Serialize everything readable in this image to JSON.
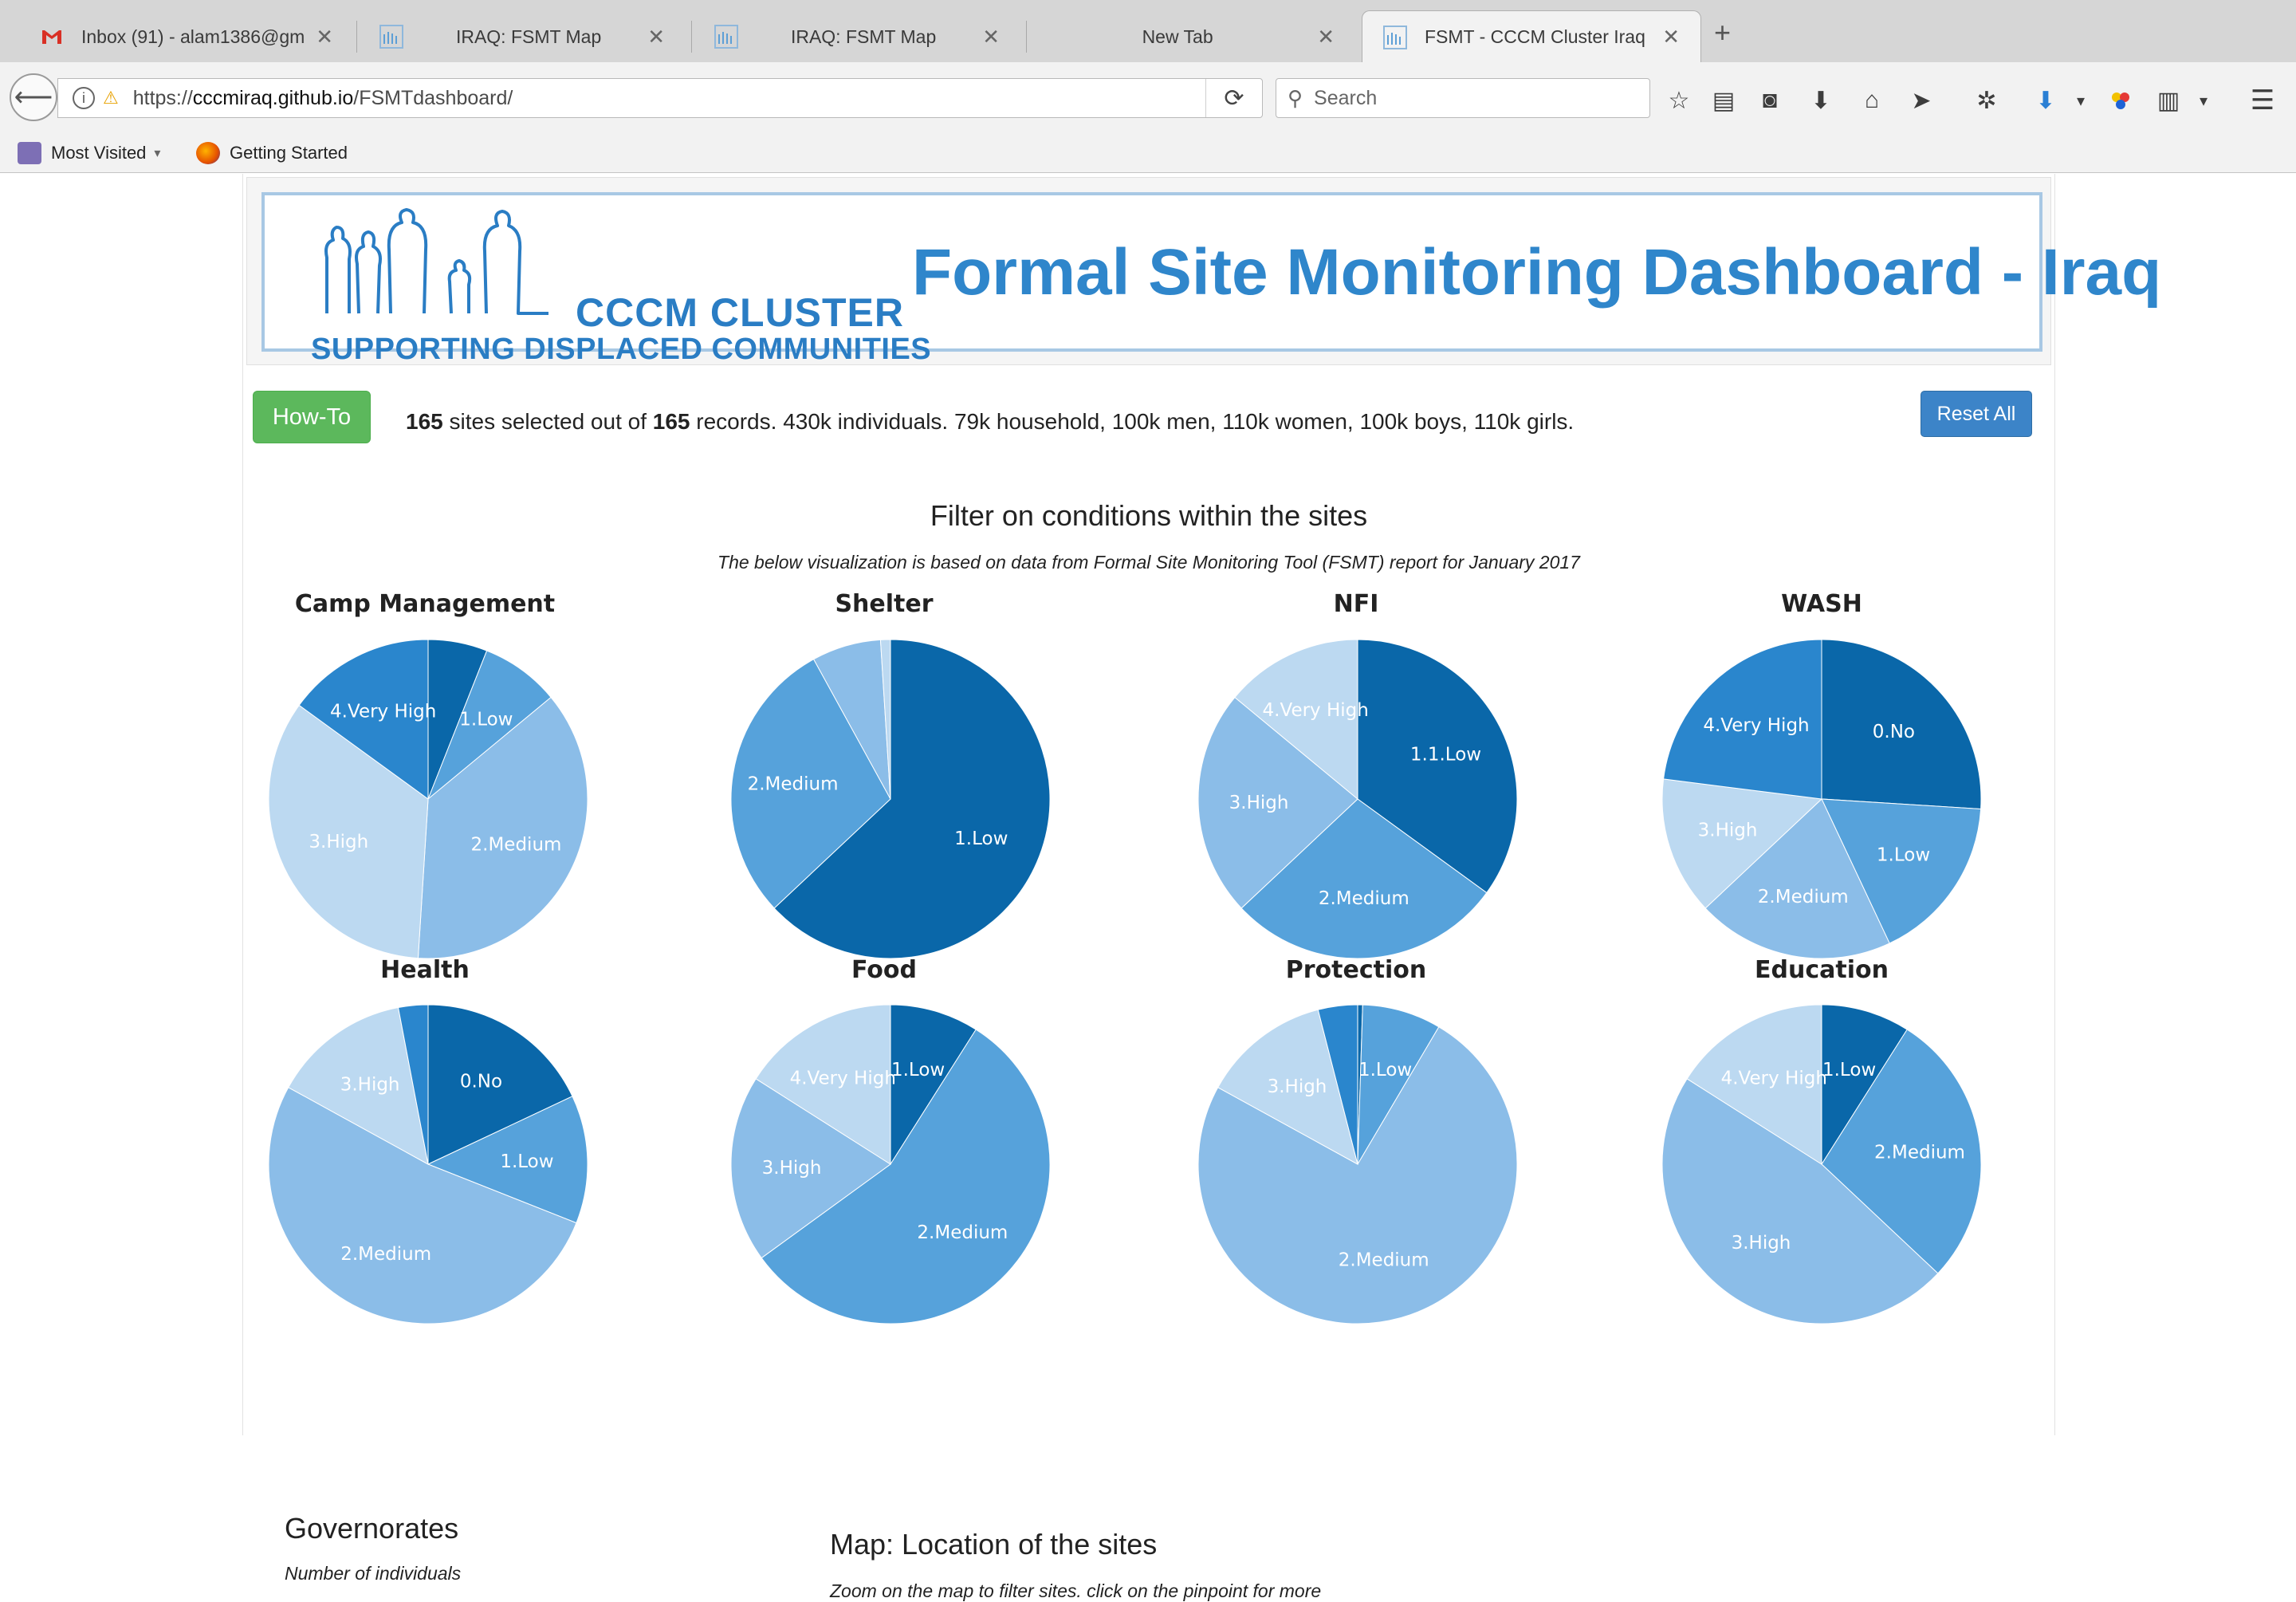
{
  "browser": {
    "tabs": [
      {
        "label": "Inbox (91) - alam1386@gm...",
        "icon": "gmail-icon"
      },
      {
        "label": "IRAQ: FSMT Map",
        "icon": "cccm-favicon"
      },
      {
        "label": "IRAQ: FSMT Map",
        "icon": "cccm-favicon"
      },
      {
        "label": "New Tab",
        "icon": ""
      },
      {
        "label": "FSMT - CCCM Cluster Iraq",
        "icon": "cccm-favicon",
        "active": true
      }
    ],
    "url_prefix": "https://",
    "url_host": "cccmiraq.github.io",
    "url_path": "/FSMTdashboard/",
    "search_placeholder": "Search",
    "bookmarks": [
      "Most Visited",
      "Getting Started"
    ]
  },
  "banner": {
    "org_name": "CCCM CLUSTER",
    "org_tagline": "SUPPORTING DISPLACED COMMUNITIES",
    "title": "Formal Site Monitoring Dashboard - Iraq"
  },
  "toolbar": {
    "howto_label": "How-To",
    "reset_label": "Reset All"
  },
  "summary": {
    "selected": "165",
    "text1": " sites selected out of ",
    "total": "165",
    "text2": " records. 430k individuals. 79k household, 100k men, 110k women, 100k boys, 110k girls."
  },
  "filters": {
    "title": "Filter on conditions within the sites",
    "note": "The below visualization is based on data from Formal Site Monitoring Tool (FSMT) report for January 2017"
  },
  "palette": [
    "#0a67a9",
    "#2a86cd",
    "#56a2db",
    "#8bbde8",
    "#bcd9f1"
  ],
  "chart_data": [
    {
      "type": "pie",
      "title": "Camp Management",
      "slices": [
        {
          "label": "",
          "value": 6,
          "color": "#0a67a9"
        },
        {
          "label": "1.Low",
          "value": 8,
          "color": "#56a2db"
        },
        {
          "label": "2.Medium",
          "value": 37,
          "color": "#8bbde8"
        },
        {
          "label": "3.High",
          "value": 34,
          "color": "#bcd9f1"
        },
        {
          "label": "4.Very High",
          "value": 15,
          "color": "#2a86cd"
        }
      ]
    },
    {
      "type": "pie",
      "title": "Shelter",
      "slices": [
        {
          "label": "1.Low",
          "value": 63,
          "color": "#0a67a9"
        },
        {
          "label": "2.Medium",
          "value": 29,
          "color": "#56a2db"
        },
        {
          "label": "",
          "value": 7,
          "color": "#8bbde8"
        },
        {
          "label": "",
          "value": 1,
          "color": "#bcd9f1"
        }
      ]
    },
    {
      "type": "pie",
      "title": "NFI",
      "slices": [
        {
          "label": "1.1.Low",
          "value": 35,
          "color": "#0a67a9"
        },
        {
          "label": "2.Medium",
          "value": 28,
          "color": "#56a2db"
        },
        {
          "label": "3.High",
          "value": 23,
          "color": "#8bbde8"
        },
        {
          "label": "4.Very High",
          "value": 14,
          "color": "#bcd9f1"
        }
      ]
    },
    {
      "type": "pie",
      "title": "WASH",
      "slices": [
        {
          "label": "0.No",
          "value": 26,
          "color": "#0a67a9"
        },
        {
          "label": "1.Low",
          "value": 17,
          "color": "#56a2db"
        },
        {
          "label": "2.Medium",
          "value": 20,
          "color": "#8bbde8"
        },
        {
          "label": "3.High",
          "value": 14,
          "color": "#bcd9f1"
        },
        {
          "label": "4.Very High",
          "value": 23,
          "color": "#2a86cd"
        }
      ]
    },
    {
      "type": "pie",
      "title": "Health",
      "slices": [
        {
          "label": "0.No",
          "value": 18,
          "color": "#0a67a9"
        },
        {
          "label": "1.Low",
          "value": 13,
          "color": "#56a2db"
        },
        {
          "label": "2.Medium",
          "value": 52,
          "color": "#8bbde8"
        },
        {
          "label": "3.High",
          "value": 14,
          "color": "#bcd9f1"
        },
        {
          "label": "",
          "value": 3,
          "color": "#2a86cd"
        }
      ]
    },
    {
      "type": "pie",
      "title": "Food",
      "slices": [
        {
          "label": "1.Low",
          "value": 9,
          "color": "#0a67a9"
        },
        {
          "label": "2.Medium",
          "value": 56,
          "color": "#56a2db"
        },
        {
          "label": "3.High",
          "value": 19,
          "color": "#8bbde8"
        },
        {
          "label": "4.Very High",
          "value": 16,
          "color": "#bcd9f1"
        }
      ]
    },
    {
      "type": "pie",
      "title": "Protection",
      "slices": [
        {
          "label": "",
          "value": 0.5,
          "color": "#0a67a9"
        },
        {
          "label": "1.Low",
          "value": 8,
          "color": "#56a2db"
        },
        {
          "label": "2.Medium",
          "value": 74.5,
          "color": "#8bbde8"
        },
        {
          "label": "3.High",
          "value": 13,
          "color": "#bcd9f1"
        },
        {
          "label": "",
          "value": 4,
          "color": "#2a86cd"
        }
      ]
    },
    {
      "type": "pie",
      "title": "Education",
      "slices": [
        {
          "label": "1.Low",
          "value": 9,
          "color": "#0a67a9"
        },
        {
          "label": "2.Medium",
          "value": 28,
          "color": "#56a2db"
        },
        {
          "label": "3.High",
          "value": 47,
          "color": "#8bbde8"
        },
        {
          "label": "4.Very High",
          "value": 16,
          "color": "#bcd9f1"
        }
      ]
    }
  ],
  "governorates": {
    "title": "Governorates",
    "note": "Number of individuals"
  },
  "map": {
    "title": "Map: Location of the sites",
    "note": "Zoom on the map to filter sites. click on the pinpoint for more"
  }
}
